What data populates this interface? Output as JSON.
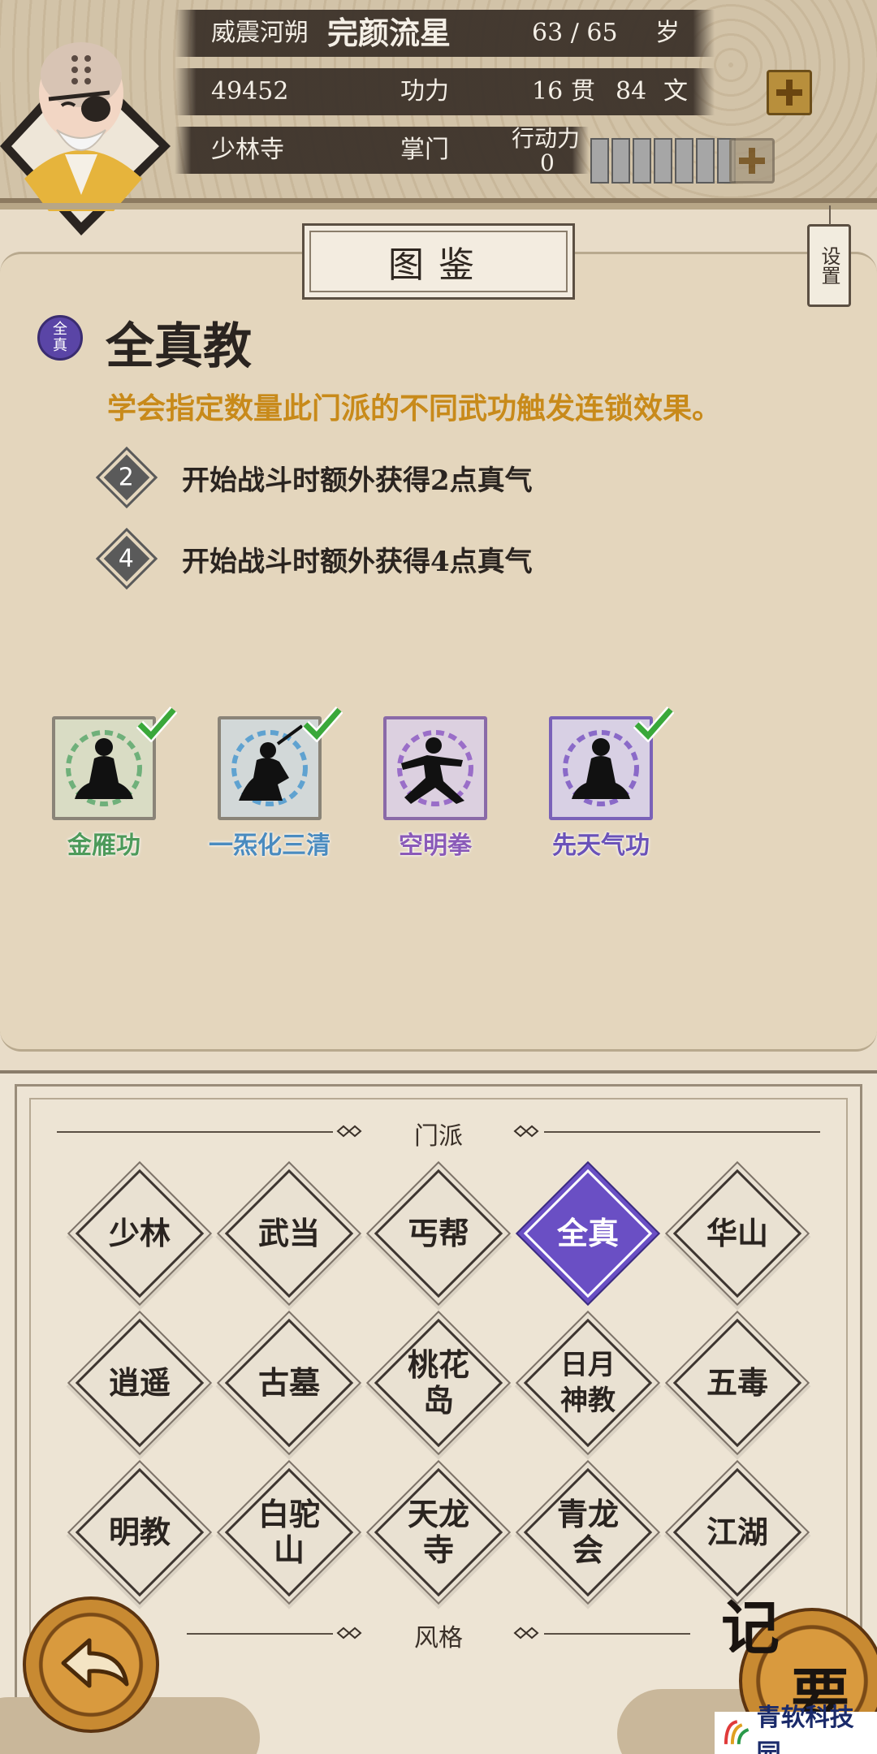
{
  "header": {
    "title_label": "威震河朔",
    "name": "完颜流星",
    "age": "63 / 65",
    "age_unit": "岁",
    "power_value": "49452",
    "power_label": "功力",
    "money_guan": "16",
    "money_guan_unit": "贯",
    "money_wen": "84",
    "money_wen_unit": "文",
    "sect": "少林寺",
    "rank": "掌门",
    "action_label": "行动力",
    "action_value": "0"
  },
  "panel": {
    "title": "图鉴",
    "settings_label": "设置",
    "sect_badge": "全真",
    "sect_name": "全真教",
    "description": "学会指定数量此门派的不同武功触发连锁效果。",
    "effects": [
      {
        "count": "2",
        "text": "开始战斗时额外获得2点真气"
      },
      {
        "count": "4",
        "text": "开始战斗时额外获得4点真气"
      }
    ],
    "skills": [
      {
        "name": "金雁功",
        "learned": true,
        "color": "#4d9a5a"
      },
      {
        "name": "一炁化三清",
        "learned": true,
        "color": "#4a8bbf"
      },
      {
        "name": "空明拳",
        "learned": false,
        "color": "#8a5ab8"
      },
      {
        "name": "先天气功",
        "learned": true,
        "color": "#6a52b8"
      }
    ]
  },
  "sects_section": {
    "label": "门派",
    "buttons": [
      "少林",
      "武当",
      "丐帮",
      "全真",
      "华山",
      "逍遥",
      "古墓",
      "桃花岛",
      "日月神教",
      "五毒",
      "明教",
      "白驼山",
      "天龙寺",
      "青龙会",
      "江湖"
    ],
    "active": "全真"
  },
  "style_section": {
    "label": "风格"
  },
  "memo_label": "记要",
  "watermark": "青软科技园",
  "colors": {
    "accent": "#6a4fc4",
    "gold_text": "#c88a1a"
  }
}
